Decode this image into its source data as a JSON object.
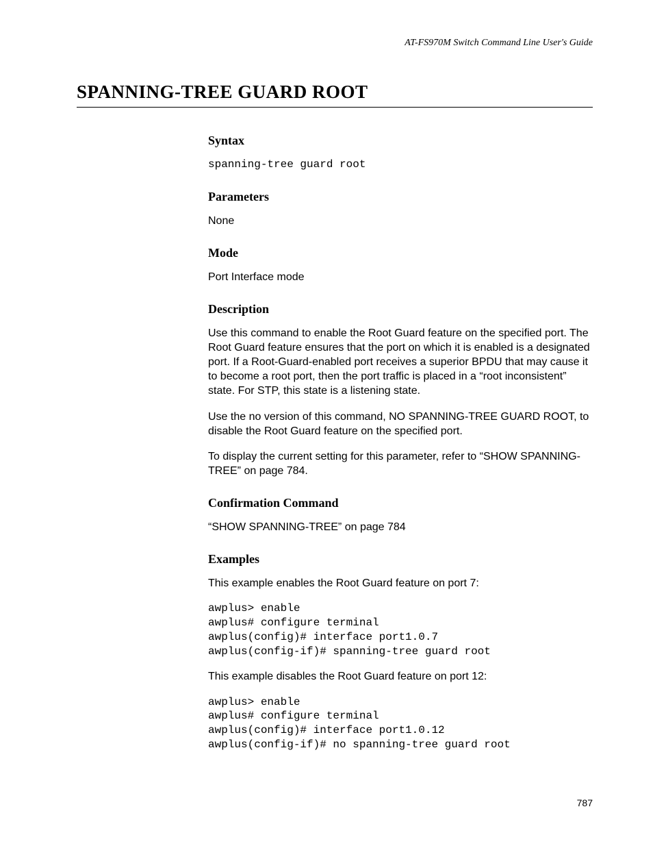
{
  "header": {
    "running_title": "AT-FS970M Switch Command Line User's Guide"
  },
  "title": "SPANNING-TREE GUARD ROOT",
  "sections": {
    "syntax": {
      "heading": "Syntax",
      "code": "spanning-tree guard root"
    },
    "parameters": {
      "heading": "Parameters",
      "text": "None"
    },
    "mode": {
      "heading": "Mode",
      "text": "Port Interface mode"
    },
    "description": {
      "heading": "Description",
      "p1": "Use this command to enable the Root Guard feature on the specified port. The Root Guard feature ensures that the port on which it is enabled is a designated port. If a Root-Guard-enabled port receives a superior BPDU that may cause it to become a root port, then the port traffic is placed in a “root inconsistent” state. For STP, this state is a listening state.",
      "p2": "Use the no version of this command, NO SPANNING-TREE GUARD ROOT, to disable the Root Guard feature on the specified port.",
      "p3": "To display the current setting for this parameter, refer to “SHOW SPANNING-TREE” on page 784."
    },
    "confirmation": {
      "heading": "Confirmation Command",
      "text": "“SHOW SPANNING-TREE” on page 784"
    },
    "examples": {
      "heading": "Examples",
      "intro1": "This example enables the Root Guard feature on port 7:",
      "code1": "awplus> enable\nawplus# configure terminal\nawplus(config)# interface port1.0.7\nawplus(config-if)# spanning-tree guard root",
      "intro2": "This example disables the Root Guard feature on port 12:",
      "code2": "awplus> enable\nawplus# configure terminal\nawplus(config)# interface port1.0.12\nawplus(config-if)# no spanning-tree guard root"
    }
  },
  "footer": {
    "page_number": "787"
  }
}
